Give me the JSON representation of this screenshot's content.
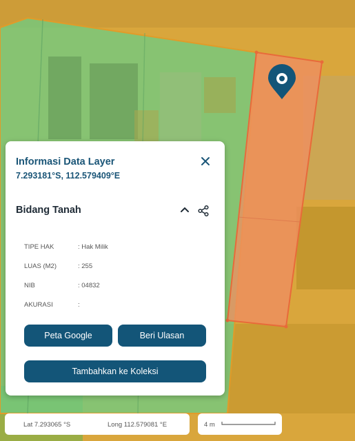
{
  "panel": {
    "title": "Informasi Data Layer",
    "coords": "7.293181°S, 112.579409°E",
    "section_title": "Bidang Tanah",
    "rows": [
      {
        "key": "TIPE HAK",
        "value": ": Hak Milik"
      },
      {
        "key": "LUAS (M2)",
        "value": ": 255"
      },
      {
        "key": "NIB",
        "value": ": 04832"
      },
      {
        "key": "AKURASI",
        "value": ":"
      }
    ],
    "buttons": {
      "google": "Peta Google",
      "review": "Beri Ulasan",
      "collection": "Tambahkan ke Koleksi"
    }
  },
  "status": {
    "lat": "Lat 7.293065 °S",
    "long": "Long 112.579081 °E"
  },
  "scale": {
    "label": "4 m"
  },
  "colors": {
    "primary": "#135578",
    "parcel_green": "#5fcf8f",
    "parcel_selected": "#f08a6a",
    "map_overlay": "#e3a62a"
  },
  "icons": [
    "map-pin-icon",
    "close-icon",
    "chevron-up-icon",
    "share-icon"
  ]
}
